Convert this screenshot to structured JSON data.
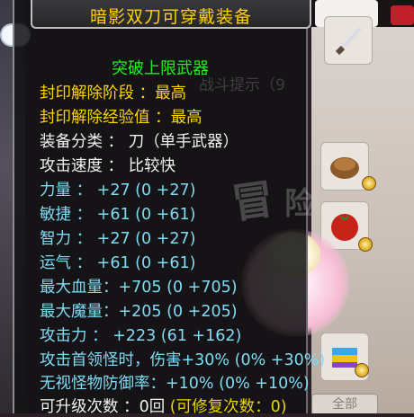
{
  "tooltip": {
    "title": "暗影双刀可穿戴装备",
    "limit_break": "突破上限武器",
    "faint_text": "战斗提示（9",
    "seal": {
      "stage_label": "封印解除阶段 ：",
      "stage_value": "最高",
      "exp_label": "封印解除经验值 ：",
      "exp_value": "最高"
    },
    "category": "装备分类 ： 刀（单手武器）",
    "speed": "攻击速度 ： 比较快",
    "stats": [
      {
        "label": "力量 ：",
        "value": "+27 (0 +27)"
      },
      {
        "label": "敏捷 ：",
        "value": "+61 (0 +61)"
      },
      {
        "label": "智力 ：",
        "value": "+27 (0 +27)"
      },
      {
        "label": "运气 ：",
        "value": "+61 (0 +61)"
      },
      {
        "label": "最大血量：",
        "value": "+705 (0 +705)"
      },
      {
        "label": "最大魔量：",
        "value": "+205 (0 +205)"
      },
      {
        "label": "攻击力 ：",
        "value": "+223 (61 +162)"
      },
      {
        "label": "攻击首领怪时，伤害",
        "value": "+30% (0% +30%)"
      },
      {
        "label": "无视怪物防御率：",
        "value": "+10% (0% +10%)"
      }
    ],
    "upgrades_label": "可升级次数 ：",
    "upgrades_value": "0回",
    "repairs": "(可修复次数：0)"
  },
  "background": {
    "button_label": "全部"
  },
  "colors": {
    "title": "#ffd200",
    "limit_break": "#22ee22",
    "stat_text": "#7fdcf5",
    "repair_text": "#e9d500"
  }
}
